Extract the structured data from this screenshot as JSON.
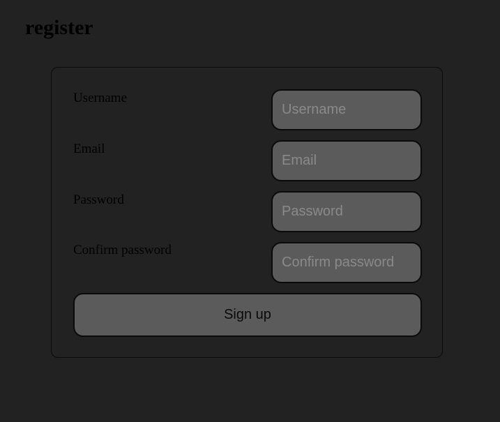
{
  "page": {
    "title": "register"
  },
  "form": {
    "fields": [
      {
        "label": "Username",
        "placeholder": "Username",
        "value": ""
      },
      {
        "label": "Email",
        "placeholder": "Email",
        "value": ""
      },
      {
        "label": "Password",
        "placeholder": "Password",
        "value": ""
      },
      {
        "label": "Confirm password",
        "placeholder": "Confirm password",
        "value": ""
      }
    ],
    "submit_label": "Sign up"
  },
  "colors": {
    "background": "#222222",
    "input_fill": "#5b5b5b",
    "border": "#0a0a0a",
    "placeholder": "#8a8a8a"
  }
}
